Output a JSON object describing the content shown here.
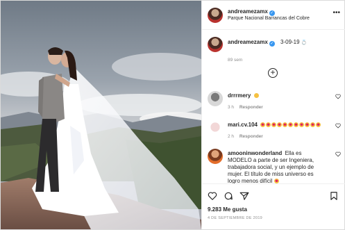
{
  "post": {
    "author": "andreamezamx",
    "location": "Parque Nacional Barrancas del Cobre"
  },
  "caption": {
    "username": "andreamezamx",
    "text": "3-09-19",
    "time": "89 sem"
  },
  "comments": [
    {
      "username": "drrrmery",
      "text": "",
      "emoji_count": 1,
      "time": "3 h",
      "reply_label": "Responder"
    },
    {
      "username": "mari.cv.104",
      "text": "",
      "emoji_count": 11,
      "time": "2 h",
      "reply_label": "Responder"
    },
    {
      "username": "amooninwonderland",
      "text": "Ella es MODELO a parte de ser Ingeniera, trabajadora social, y un ejemplo de mujer. El título de miss universo es logro menos difícil",
      "emoji_count": 1
    }
  ],
  "footer": {
    "likes": "9.283 Me gusta",
    "date": "4 DE SEPTIEMBRE DE 2019"
  },
  "colors": {
    "verified": "#3897f0",
    "muted": "#8e8e8e",
    "text": "#262626",
    "border": "#dbdbdb"
  },
  "icons": [
    "more-options-icon",
    "verified-icon",
    "load-more-icon",
    "heart-icon",
    "comment-icon",
    "share-icon",
    "bookmark-icon"
  ]
}
